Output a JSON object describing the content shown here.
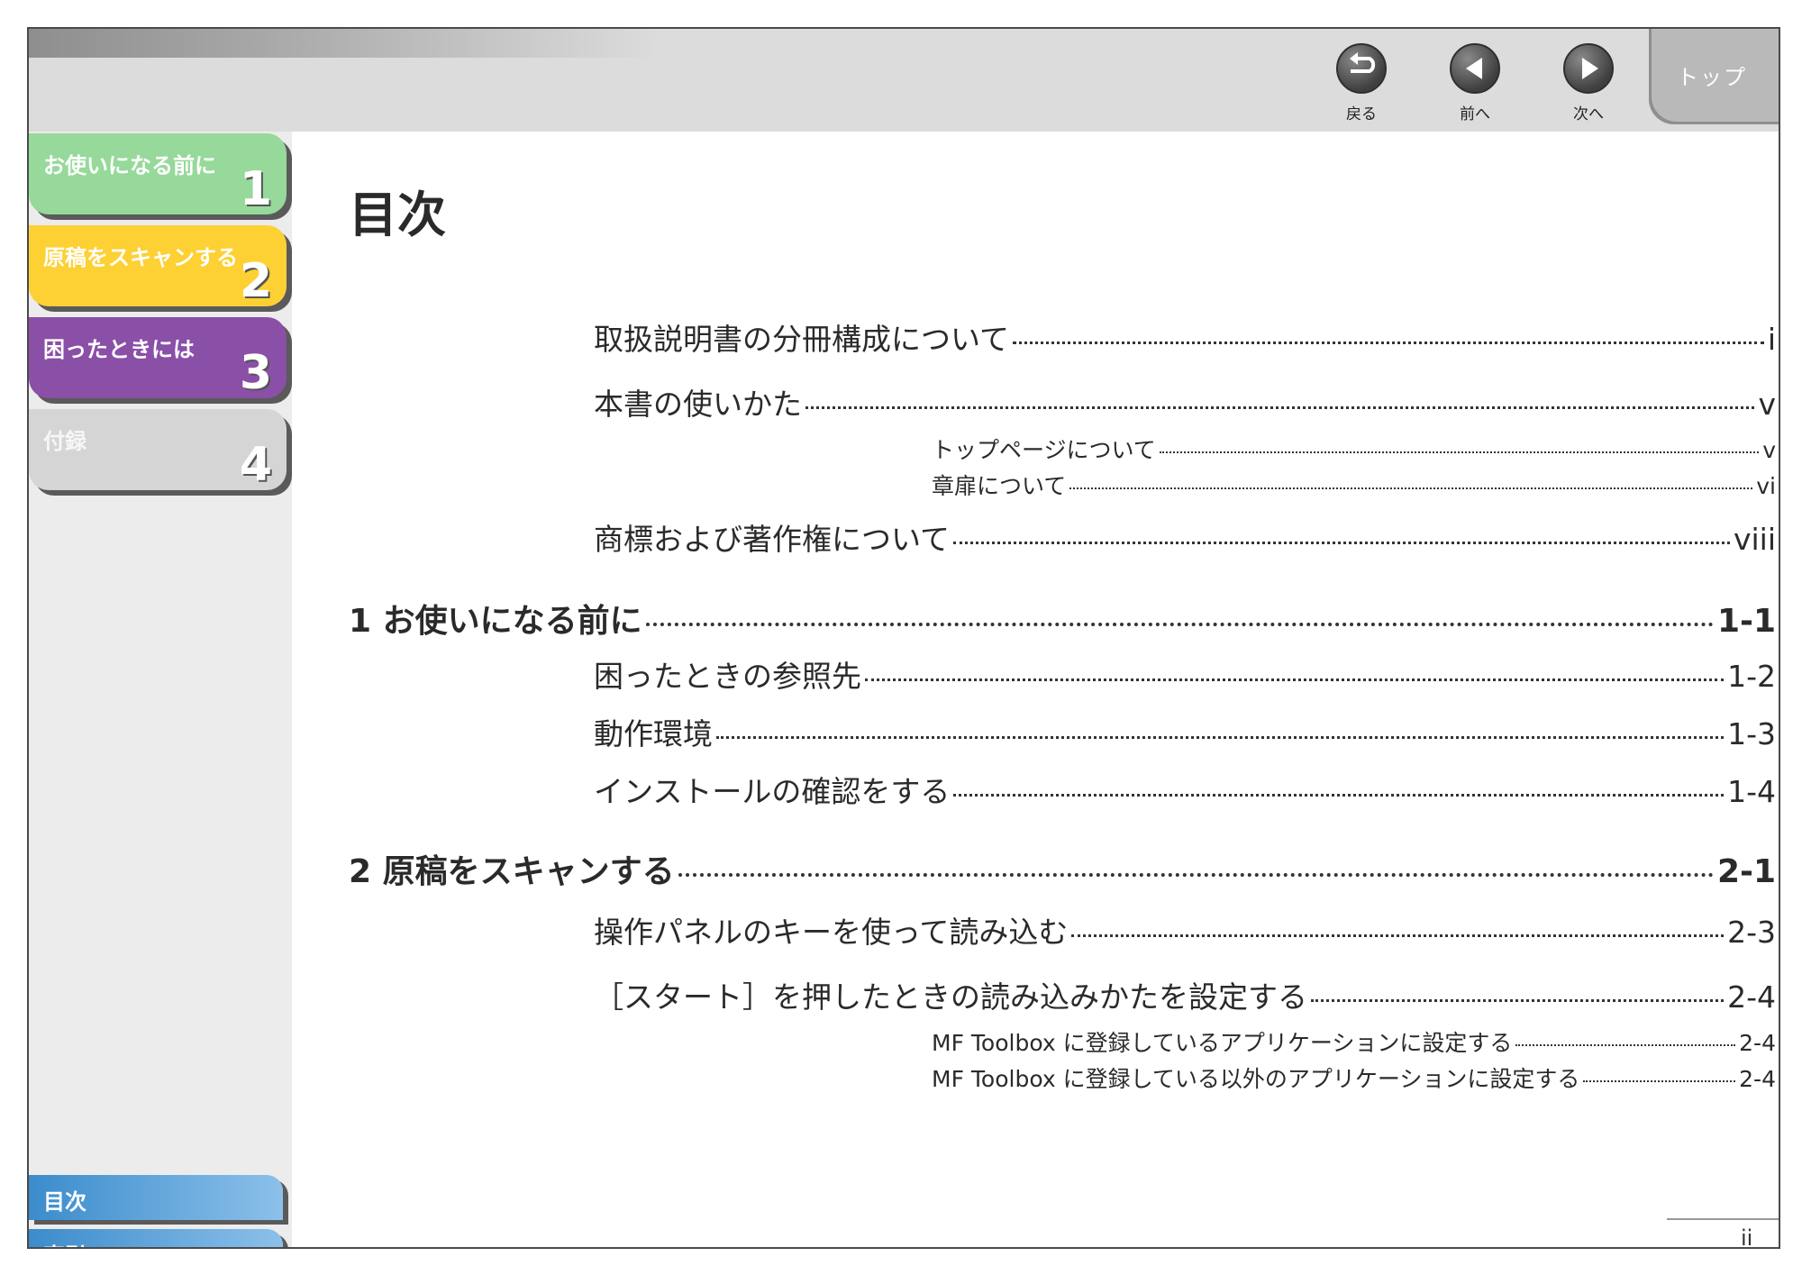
{
  "header": {
    "nav": {
      "back_label": "戻る",
      "prev_label": "前へ",
      "next_label": "次へ"
    },
    "top_tab_label": "トップ"
  },
  "sidebar": {
    "chapters": [
      {
        "label": "お使いになる前に",
        "number": "1",
        "color": "#96d99a"
      },
      {
        "label": "原稿をスキャンする",
        "number": "2",
        "color": "#fdd034"
      },
      {
        "label": "困ったときには",
        "number": "3",
        "color": "#8a4fa6"
      },
      {
        "label": "付録",
        "number": "4",
        "color": "#d5d5d5"
      }
    ],
    "links": [
      {
        "label": "目次"
      },
      {
        "label": "索引"
      }
    ]
  },
  "main": {
    "title": "目次",
    "toc": [
      {
        "label": "取扱説明書の分冊構成について",
        "page": "i"
      },
      {
        "label": "本書の使いかた",
        "page": "v"
      },
      {
        "label": "トップページについて",
        "page": "v"
      },
      {
        "label": "章扉について",
        "page": "vi"
      },
      {
        "label": "商標および著作権について",
        "page": "viii"
      },
      {
        "label": "1 お使いになる前に",
        "page": "1-1"
      },
      {
        "label": "困ったときの参照先",
        "page": "1-2"
      },
      {
        "label": "動作環境",
        "page": "1-3"
      },
      {
        "label": "インストールの確認をする",
        "page": "1-4"
      },
      {
        "label": "2 原稿をスキャンする",
        "page": "2-1"
      },
      {
        "label": "操作パネルのキーを使って読み込む",
        "page": "2-3"
      },
      {
        "label": "［スタート］を押したときの読み込みかたを設定する",
        "page": "2-4"
      },
      {
        "label": "MF Toolbox に登録しているアプリケーションに設定する",
        "page": "2-4"
      },
      {
        "label": "MF Toolbox に登録している以外のアプリケーションに設定する",
        "page": "2-4"
      }
    ]
  },
  "footer": {
    "page_number": "ii"
  }
}
